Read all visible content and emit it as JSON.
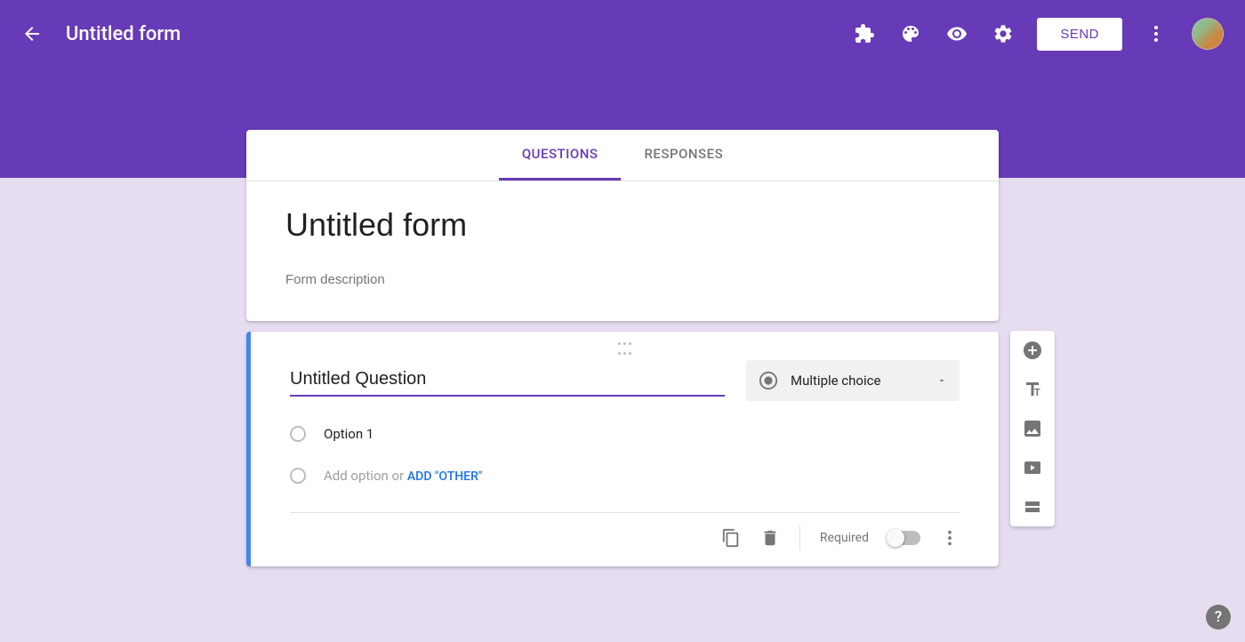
{
  "header": {
    "title": "Untitled form",
    "send_label": "SEND"
  },
  "tabs": {
    "questions": "QUESTIONS",
    "responses": "RESPONSES"
  },
  "form": {
    "title": "Untitled form",
    "description_placeholder": "Form description"
  },
  "question": {
    "title": "Untitled Question",
    "type_label": "Multiple choice",
    "option1": "Option 1",
    "add_option": "Add option",
    "or_text": " or ",
    "add_other": "ADD \"OTHER\"",
    "required_label": "Required"
  }
}
